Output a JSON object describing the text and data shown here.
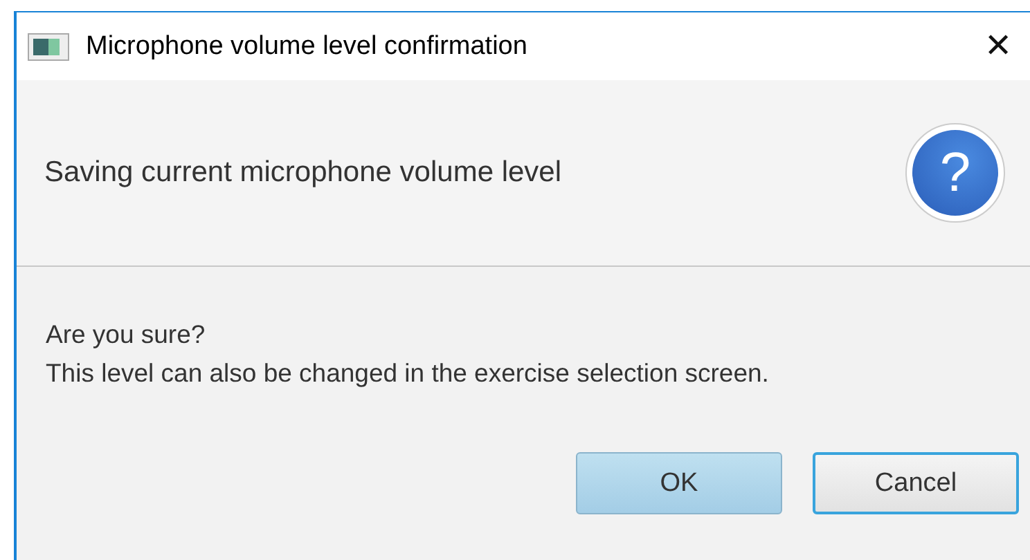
{
  "window": {
    "title": "Microphone volume level confirmation",
    "close": "✕"
  },
  "header": {
    "text": "Saving current microphone volume level",
    "icon": "?"
  },
  "content": [
    "Are you sure?",
    "This level can also be changed in the exercise selection screen."
  ],
  "buttons": [
    {
      "label": "OK",
      "default": true,
      "focused": false
    },
    {
      "label": "Cancel",
      "default": false,
      "focused": true
    }
  ]
}
